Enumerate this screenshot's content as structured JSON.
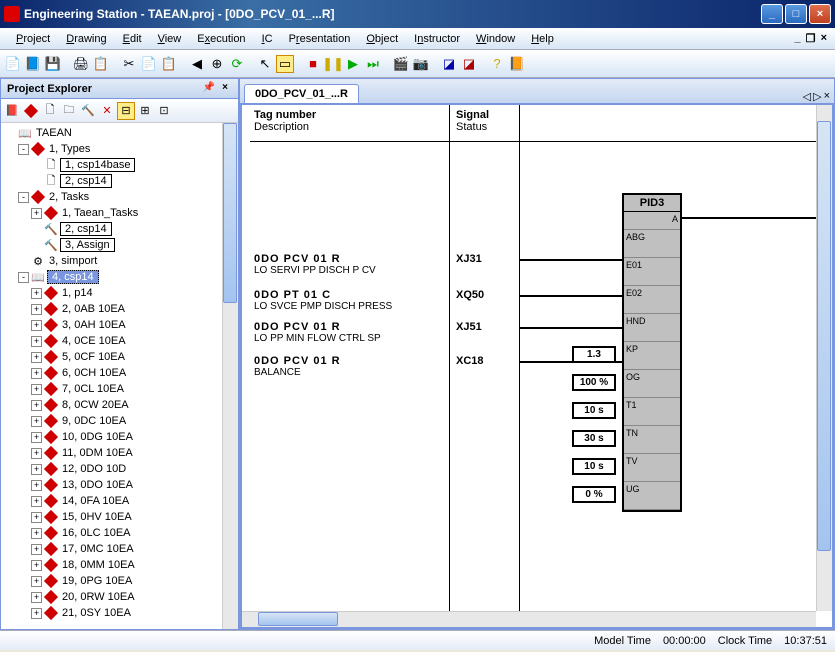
{
  "window": {
    "title": "Engineering Station - TAEAN.proj - [0DO_PCV_01_...R]"
  },
  "menus": [
    "Project",
    "Drawing",
    "Edit",
    "View",
    "Execution",
    "IC",
    "Presentation",
    "Object",
    "Instructor",
    "Window",
    "Help"
  ],
  "explorer": {
    "title": "Project Explorer",
    "root": "TAEAN",
    "types": {
      "label": "1, Types",
      "items": [
        "1, csp14base",
        "2, csp14"
      ]
    },
    "tasks": {
      "label": "2, Tasks",
      "items": [
        "1, Taean_Tasks",
        "2, csp14",
        "3, Assign"
      ]
    },
    "simport": "3, simport",
    "csp14": {
      "label": "4, csp14",
      "items": [
        "1, p14",
        "2, 0AB 10EA",
        "3, 0AH 10EA",
        "4, 0CE 10EA",
        "5, 0CF 10EA",
        "6, 0CH 10EA",
        "7, 0CL 10EA",
        "8, 0CW 20EA",
        "9, 0DC 10EA",
        "10, 0DG 10EA",
        "11, 0DM 10EA",
        "12, 0DO 10D",
        "13, 0DO 10EA",
        "14, 0FA 10EA",
        "15, 0HV 10EA",
        "16, 0LC 10EA",
        "17, 0MC 10EA",
        "18, 0MM 10EA",
        "19, 0PG 10EA",
        "20, 0RW 10EA",
        "21, 0SY 10EA"
      ]
    }
  },
  "tab": "0DO_PCV_01_...R",
  "columns": {
    "tag": "Tag number",
    "tagdesc": "Description",
    "sig": "Signal",
    "sigdesc": "Status"
  },
  "rows": [
    {
      "tag": "0DO PCV 01   R",
      "desc": "LO SERVI PP DISCH P CV",
      "sig": "XJ31"
    },
    {
      "tag": "0DO PT   01   C",
      "desc": "LO SVCE PMP DISCH PRESS",
      "sig": "XQ50"
    },
    {
      "tag": "0DO PCV 01   R",
      "desc": "LO PP MIN FLOW CTRL SP",
      "sig": "XJ51"
    },
    {
      "tag": "0DO PCV 01   R",
      "desc": "BALANCE",
      "sig": "XC18"
    }
  ],
  "block": {
    "name": "PID3",
    "out": "A",
    "ports": [
      {
        "label": "ABG"
      },
      {
        "label": "E01"
      },
      {
        "label": "E02"
      },
      {
        "label": "HND"
      },
      {
        "label": "KP",
        "val": "1.3"
      },
      {
        "label": "OG",
        "val": "100 %"
      },
      {
        "label": "T1",
        "val": "10 s"
      },
      {
        "label": "TN",
        "val": "30 s"
      },
      {
        "label": "TV",
        "val": "10 s"
      },
      {
        "label": "UG",
        "val": "0 %"
      }
    ]
  },
  "status": {
    "model_label": "Model Time",
    "model": "00:00:00",
    "clock_label": "Clock Time",
    "clock": "10:37:51"
  }
}
